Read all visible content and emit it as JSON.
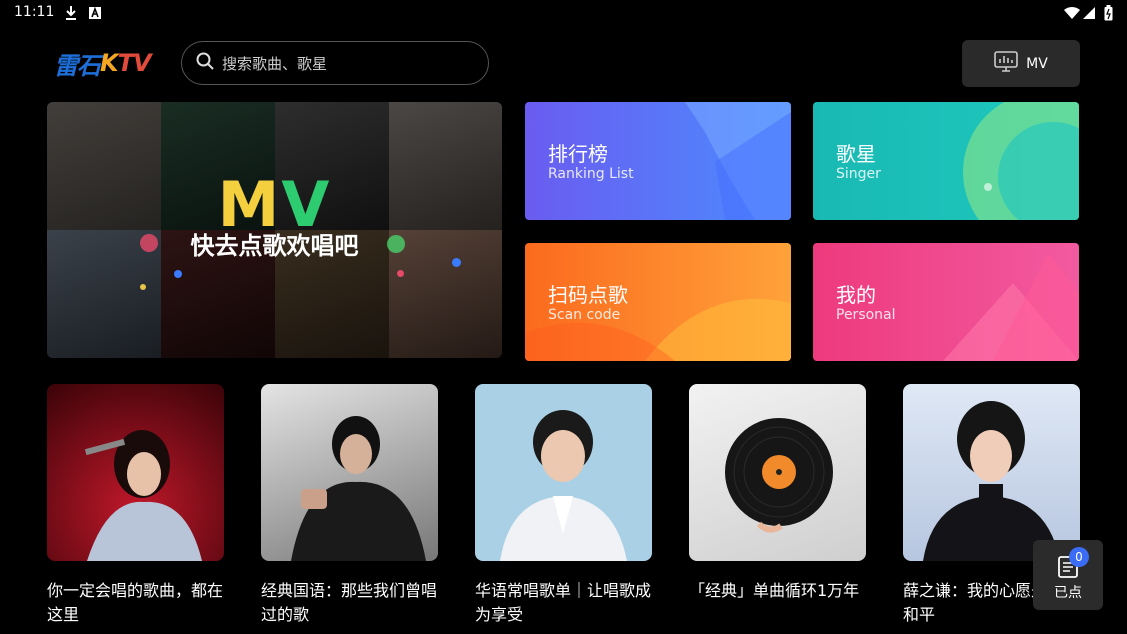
{
  "status_bar": {
    "time": "11:11"
  },
  "header": {
    "logo": {
      "part1": "雷石",
      "part2": "K",
      "part3": "TV"
    },
    "search_placeholder": "搜索歌曲、歌星",
    "mv_button_label": "MV"
  },
  "banner": {
    "mv_logo_m": "M",
    "mv_logo_v": "V",
    "text": "快去点歌欢唱吧"
  },
  "categories": [
    {
      "title": "排行榜",
      "subtitle": "Ranking List"
    },
    {
      "title": "歌星",
      "subtitle": "Singer"
    },
    {
      "title": "扫码点歌",
      "subtitle": "Scan code"
    },
    {
      "title": "我的",
      "subtitle": "Personal"
    }
  ],
  "playlists": [
    {
      "label": "你一定会唱的歌曲，都在这里"
    },
    {
      "label": "经典国语：那些我们曾唱过的歌"
    },
    {
      "label": "华语常唱歌单｜让唱歌成为享受"
    },
    {
      "label": "「经典」单曲循环1万年"
    },
    {
      "label": "薛之谦：我的心愿是世界和平"
    }
  ],
  "queue": {
    "count": "0",
    "label": "已点"
  },
  "colors": {
    "ranking": "#6a5cf0",
    "singer": "#19b9b3",
    "scan": "#fb6a1e",
    "personal": "#ee3a7d",
    "badge": "#3b6cf6"
  }
}
